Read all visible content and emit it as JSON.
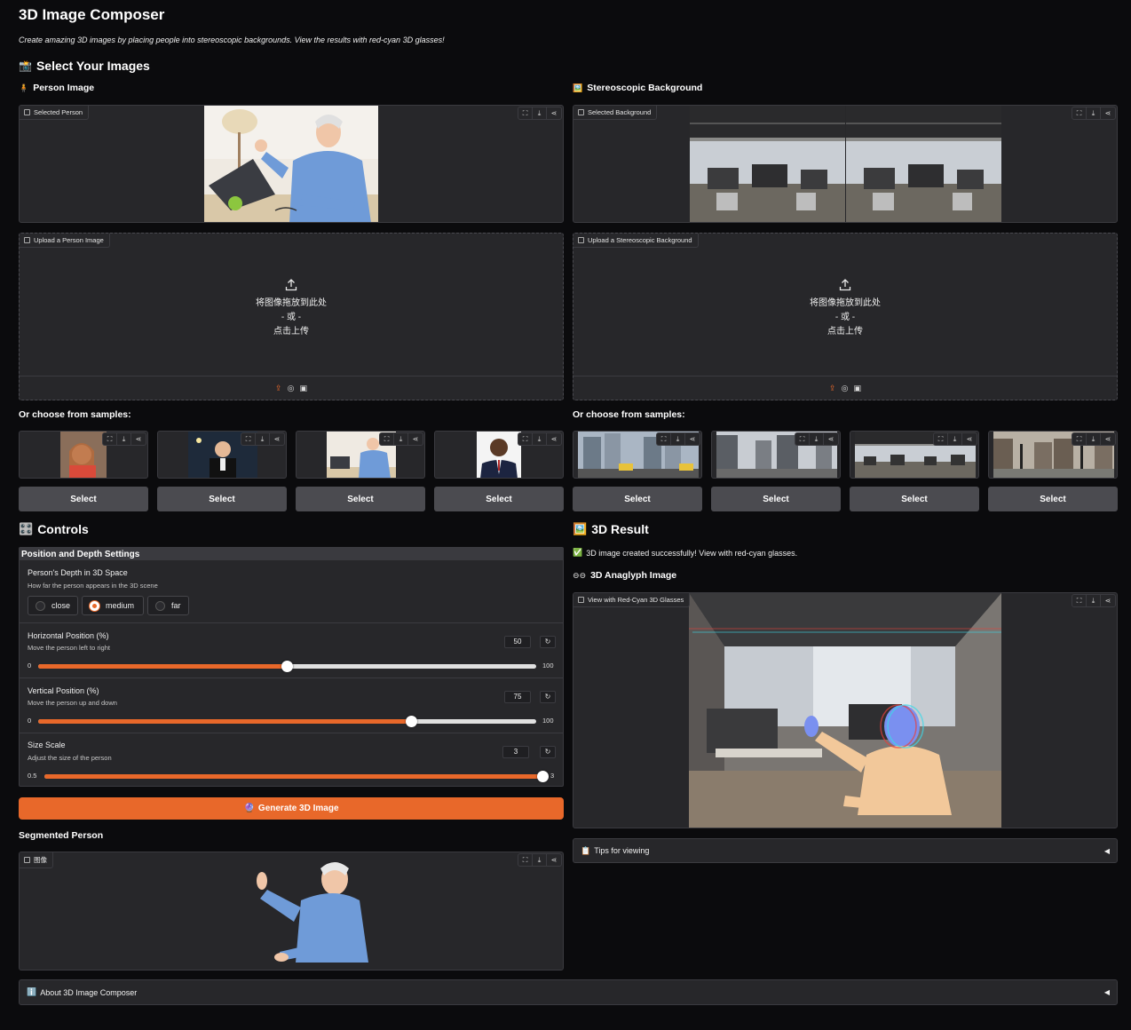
{
  "app": {
    "title": "3D Image Composer",
    "subtitle": "Create amazing 3D images by placing people into stereoscopic backgrounds. View the results with red-cyan 3D glasses!"
  },
  "select_section": {
    "heading": "Select Your Images",
    "heading_icon": "camera-emoji",
    "person": {
      "label": "Person Image",
      "icon": "person-emoji",
      "selected_tag": "Selected Person",
      "upload_tag": "Upload a Person Image",
      "upload_drop": "将图像拖放到此处",
      "upload_or": "- 或 -",
      "upload_click": "点击上传",
      "samples_label": "Or choose from samples:",
      "samples": [
        {
          "button": "Select"
        },
        {
          "button": "Select"
        },
        {
          "button": "Select"
        },
        {
          "button": "Select"
        }
      ]
    },
    "background": {
      "label": "Stereoscopic Background",
      "icon": "framed-picture-emoji",
      "selected_tag": "Selected Background",
      "upload_tag": "Upload a Stereoscopic Background",
      "upload_drop": "将图像拖放到此处",
      "upload_or": "- 或 -",
      "upload_click": "点击上传",
      "samples_label": "Or choose from samples:",
      "samples": [
        {
          "button": "Select"
        },
        {
          "button": "Select"
        },
        {
          "button": "Select"
        },
        {
          "button": "Select"
        }
      ]
    }
  },
  "controls": {
    "heading": "Controls",
    "heading_icon": "control-knobs-emoji",
    "group_title": "Position and Depth Settings",
    "depth": {
      "label": "Person's Depth in 3D Space",
      "info": "How far the person appears in the 3D scene",
      "options": [
        "close",
        "medium",
        "far"
      ],
      "selected": "medium"
    },
    "horizontal": {
      "label": "Horizontal Position (%)",
      "info": "Move the person left to right",
      "value": 50,
      "min": 0,
      "max": 100,
      "value_text": "50",
      "min_text": "0",
      "max_text": "100"
    },
    "vertical": {
      "label": "Vertical Position (%)",
      "info": "Move the person up and down",
      "value": 75,
      "min": 0,
      "max": 100,
      "value_text": "75",
      "min_text": "0",
      "max_text": "100"
    },
    "size": {
      "label": "Size Scale",
      "info": "Adjust the size of the person",
      "value": 3,
      "min": 0.5,
      "max": 3,
      "value_text": "3",
      "min_text": "0.5",
      "max_text": "3"
    },
    "generate_button": "Generate 3D Image",
    "generate_icon": "crystal-ball-emoji",
    "segmented_label": "Segmented Person",
    "segmented_tag": "图像"
  },
  "result": {
    "heading": "3D Result",
    "heading_icon": "framed-picture-emoji",
    "status_icon": "check-mark-emoji",
    "status": "3D image created successfully! View with red-cyan glasses.",
    "anaglyph_label": "3D Anaglyph Image",
    "anaglyph_icon": "glasses-emoji",
    "image_tag": "View with Red-Cyan 3D Glasses",
    "tips": "Tips for viewing",
    "tips_icon": "clipboard-emoji"
  },
  "about": {
    "label": "About 3D Image Composer",
    "icon": "info-emoji"
  },
  "colors": {
    "accent": "#e8682a",
    "panel": "#27272a",
    "background": "#0b0b0d",
    "button_gray": "#4b4b50"
  }
}
